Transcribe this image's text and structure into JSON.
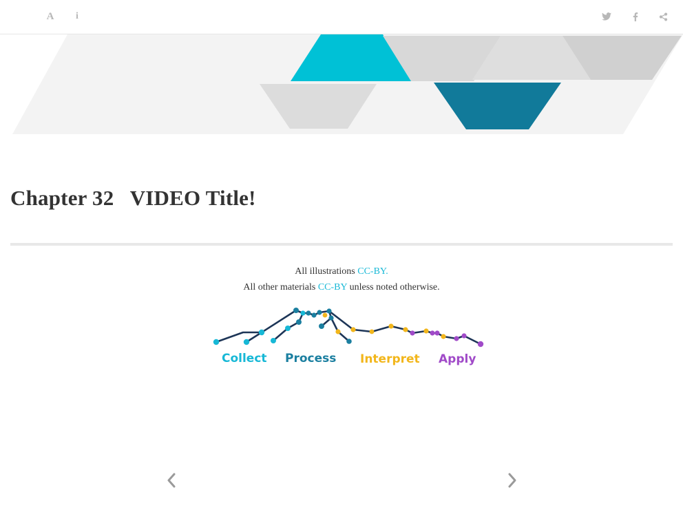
{
  "toolbar": {
    "left_buttons": [
      {
        "name": "font-settings",
        "icon": "font-icon",
        "glyph": "A"
      },
      {
        "name": "info",
        "icon": "info-icon",
        "glyph": "i"
      }
    ],
    "right_buttons": [
      {
        "name": "twitter",
        "icon": "twitter-icon"
      },
      {
        "name": "facebook",
        "icon": "facebook-icon"
      },
      {
        "name": "share",
        "icon": "share-icon"
      }
    ],
    "icon_color": "#b8b8b8"
  },
  "chapter": {
    "title": "Chapter 32   VIDEO Title!"
  },
  "license": {
    "line1_prefix": "All illustrations ",
    "line1_link": "CC-BY.",
    "line2_prefix": "All other materials ",
    "line2_link": "CC-BY",
    "line2_suffix": " unless noted otherwise.",
    "link_color": "#17b8d6"
  },
  "logo": {
    "labels": [
      {
        "text": "Collect",
        "color": "#17b8d6"
      },
      {
        "text": "Process",
        "color": "#1b7fa0"
      },
      {
        "text": "Interpret",
        "color": "#f2b61b"
      },
      {
        "text": "Apply",
        "color": "#a04ac8"
      }
    ],
    "line_color": "#1d3557"
  },
  "banner": {
    "colors": {
      "cyan": "#00c1d6",
      "teal": "#117a9a",
      "gray": "#d9d9d9",
      "light": "#f3f3f3"
    }
  },
  "navigation": {
    "prev_icon": "chevron-left-icon",
    "next_icon": "chevron-right-icon"
  }
}
